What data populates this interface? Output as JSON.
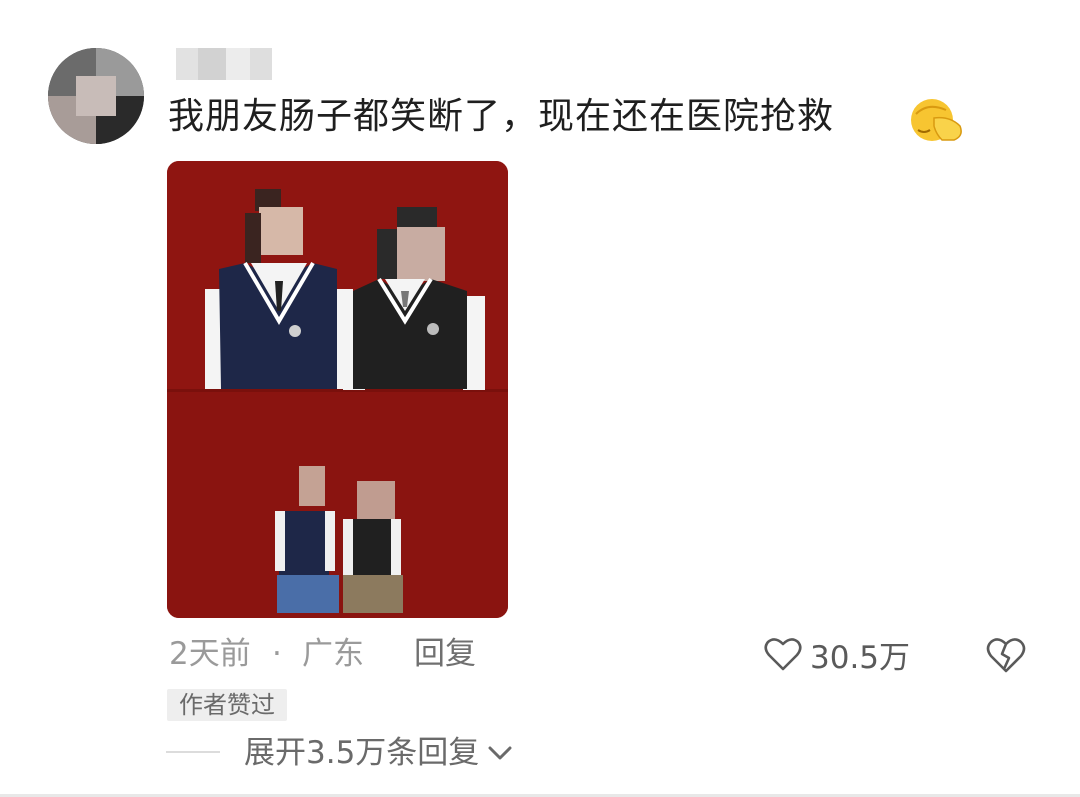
{
  "comment": {
    "text": "我朋友肠子都笑断了，现在还在医院抢救",
    "emoji": "facepalm-emoji",
    "time": "2天前",
    "separator": "·",
    "location": "广东",
    "reply_label": "回复",
    "like_count": "30.5万",
    "author_badge": "作者赞过",
    "expand_label": "展开3.5万条回复"
  },
  "colors": {
    "photo_red": "#8e1612",
    "navy_vest": "#1e2748",
    "black_vest": "#202020"
  }
}
